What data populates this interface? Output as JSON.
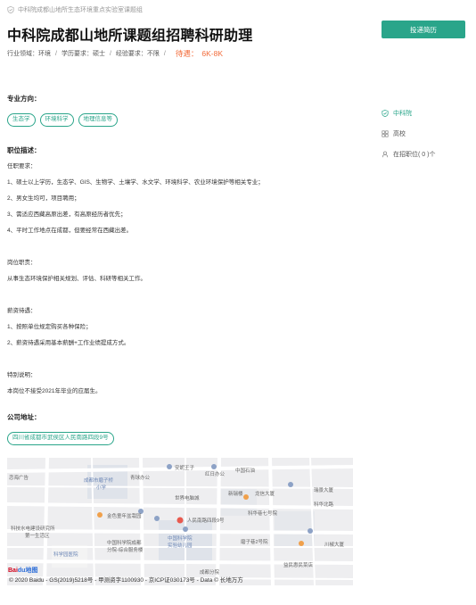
{
  "breadcrumb": "中科院成都山地所生态环境重点实验室课题组",
  "job": {
    "title": "中科院成都山地所课题组招聘科研助理",
    "apply_label": "投递简历",
    "meta": {
      "industry": "行业领域：环境",
      "education": "学历要求：硕士",
      "experience": "经验要求：不限",
      "salary_label": "待遇：",
      "salary": "6K-8K"
    }
  },
  "sections": {
    "direction_title": "专业方向：",
    "tags": [
      "生态学",
      "环境科学",
      "地理信息等"
    ],
    "desc_title": "职位描述：",
    "desc_lines": [
      "任职要求：",
      "1、硕士以上学历，生态学、GIS、生物学、土壤学、水文学、环境科学、农业环境保护等相关专业；",
      "2、男女生均可，项目聘用；",
      "3、需适应西藏高原出差，有高原经历者优先；",
      "4、平时工作地点在成都，但要经常在西藏出差。",
      "",
      "岗位职责：",
      "从事生态环境保护相关规划、评估、科研等相关工作。",
      "",
      "薪资待遇：",
      "1、按照单位规定购买各种保险；",
      "2、薪资待遇采用基本薪酬+工作业绩提成方式。",
      "",
      "特别说明：",
      "本岗位不接受2021年毕业的应届生。"
    ],
    "address_title": "公司地址：",
    "address": "四川省成都市武侯区人民南路四段9号"
  },
  "sidebar": {
    "company": "中科院",
    "type": "高校",
    "positions": "在招职位( 0 )个"
  },
  "map": {
    "labels": [
      {
        "text": "成都市磨子桥",
        "cls": "blue"
      },
      {
        "text": "小学",
        "cls": "blue"
      },
      {
        "text": "中国科学院",
        "cls": "blue"
      },
      {
        "text": "实验幼儿园",
        "cls": "blue"
      },
      {
        "text": "科学园医院",
        "cls": "blue"
      },
      {
        "text": "安妮王子",
        "cls": ""
      },
      {
        "text": "红日办公",
        "cls": ""
      },
      {
        "text": "中国石油",
        "cls": ""
      },
      {
        "text": "青球办公",
        "cls": ""
      },
      {
        "text": "世界电脑城",
        "cls": ""
      },
      {
        "text": "新瑞楼",
        "cls": ""
      },
      {
        "text": "龙信大厦",
        "cls": ""
      },
      {
        "text": "人民南路四段9号",
        "cls": ""
      },
      {
        "text": "金色童年盆栽园",
        "cls": ""
      },
      {
        "text": "科华巷七号院",
        "cls": ""
      },
      {
        "text": "磨子巷2号院",
        "cls": ""
      },
      {
        "text": "中国科学院成都",
        "cls": ""
      },
      {
        "text": "分院-综合服务楼",
        "cls": ""
      },
      {
        "text": "成都分院",
        "cls": ""
      },
      {
        "text": "益民惠民菜店",
        "cls": ""
      },
      {
        "text": "川椒大厦",
        "cls": ""
      },
      {
        "text": "科华北路",
        "cls": ""
      },
      {
        "text": "科技水电建设研究所",
        "cls": ""
      },
      {
        "text": "第一生活区",
        "cls": ""
      },
      {
        "text": "恋海广告",
        "cls": ""
      },
      {
        "text": "瑞景大厦",
        "cls": ""
      }
    ],
    "logo_prefix": "Bai",
    "logo_suffix": "du地图",
    "copyright": "© 2020 Baidu - GS(2019)5218号 - 甲测资字1100930 - 京ICP证030173号 - Data © 长地万方"
  }
}
